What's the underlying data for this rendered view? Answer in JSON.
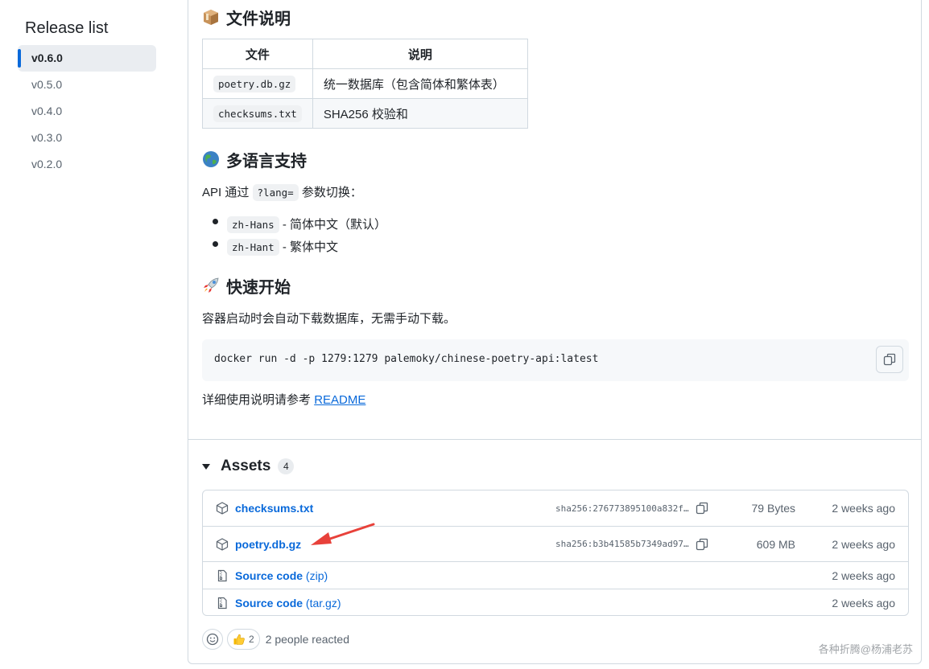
{
  "sidebar": {
    "title": "Release list",
    "items": [
      {
        "label": "v0.6.0",
        "active": true
      },
      {
        "label": "v0.5.0"
      },
      {
        "label": "v0.4.0"
      },
      {
        "label": "v0.3.0"
      },
      {
        "label": "v0.2.0"
      }
    ]
  },
  "files_section": {
    "heading": "文件说明",
    "icon": "package-icon",
    "table": {
      "headers": [
        "文件",
        "说明"
      ],
      "rows": [
        [
          "poetry.db.gz",
          "统一数据库（包含简体和繁体表）"
        ],
        [
          "checksums.txt",
          "SHA256 校验和"
        ]
      ]
    }
  },
  "lang_section": {
    "heading": "多语言支持",
    "icon": "globe-icon",
    "intro_prefix": "API 通过",
    "intro_code": "?lang=",
    "intro_suffix": "参数切换：",
    "items": [
      {
        "code": "zh-Hans",
        "text": "- 简体中文（默认）"
      },
      {
        "code": "zh-Hant",
        "text": "- 繁体中文"
      }
    ]
  },
  "quickstart": {
    "heading": "快速开始",
    "icon": "rocket-icon",
    "desc": "容器启动时会自动下载数据库，无需手动下载。",
    "command": "docker run -d -p 1279:1279 palemoky/chinese-poetry-api:latest",
    "readme_prefix": "详细使用说明请参考",
    "readme_link": "README"
  },
  "assets": {
    "title": "Assets",
    "count": "4",
    "rows": [
      {
        "name": "checksums.txt",
        "sha": "sha256:276773895100a832f…",
        "size": "79 Bytes",
        "date": "2 weeks ago",
        "icon": "package-icon"
      },
      {
        "name": "poetry.db.gz",
        "sha": "sha256:b3b41585b7349ad97…",
        "size": "609 MB",
        "date": "2 weeks ago",
        "icon": "package-icon"
      },
      {
        "name": "Source code",
        "suffix": "(zip)",
        "date": "2 weeks ago",
        "icon": "file-zip-icon"
      },
      {
        "name": "Source code",
        "suffix": "(tar.gz)",
        "date": "2 weeks ago",
        "icon": "file-zip-icon"
      }
    ]
  },
  "reactions": {
    "thumbs_count": "2",
    "summary": "2 people reacted"
  },
  "watermark": "各种折腾@杨浦老苏",
  "colors": {
    "accent": "#0969da",
    "arrow": "#e8413a"
  }
}
